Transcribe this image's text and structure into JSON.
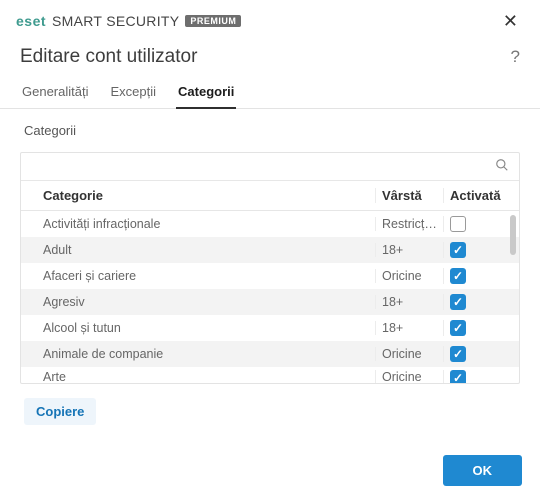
{
  "brand": {
    "mark": "eset",
    "product": "SMART SECURITY",
    "badge": "PREMIUM"
  },
  "window": {
    "title": "Editare cont utilizator"
  },
  "tabs": {
    "general": "Generalități",
    "exceptions": "Excepții",
    "categories": "Categorii",
    "active": "categories"
  },
  "section_label": "Categorii",
  "columns": {
    "category": "Categorie",
    "age": "Vârstă",
    "enabled": "Activată"
  },
  "rows": [
    {
      "category": "Activități infracționale",
      "age": "Restricțio...",
      "enabled": false
    },
    {
      "category": "Adult",
      "age": "18+",
      "enabled": true
    },
    {
      "category": "Afaceri și cariere",
      "age": "Oricine",
      "enabled": true
    },
    {
      "category": "Agresiv",
      "age": "18+",
      "enabled": true
    },
    {
      "category": "Alcool și tutun",
      "age": "18+",
      "enabled": true
    },
    {
      "category": "Animale de companie",
      "age": "Oricine",
      "enabled": true
    },
    {
      "category": "Arte",
      "age": "Oricine",
      "enabled": true
    }
  ],
  "buttons": {
    "copy": "Copiere",
    "ok": "OK"
  }
}
